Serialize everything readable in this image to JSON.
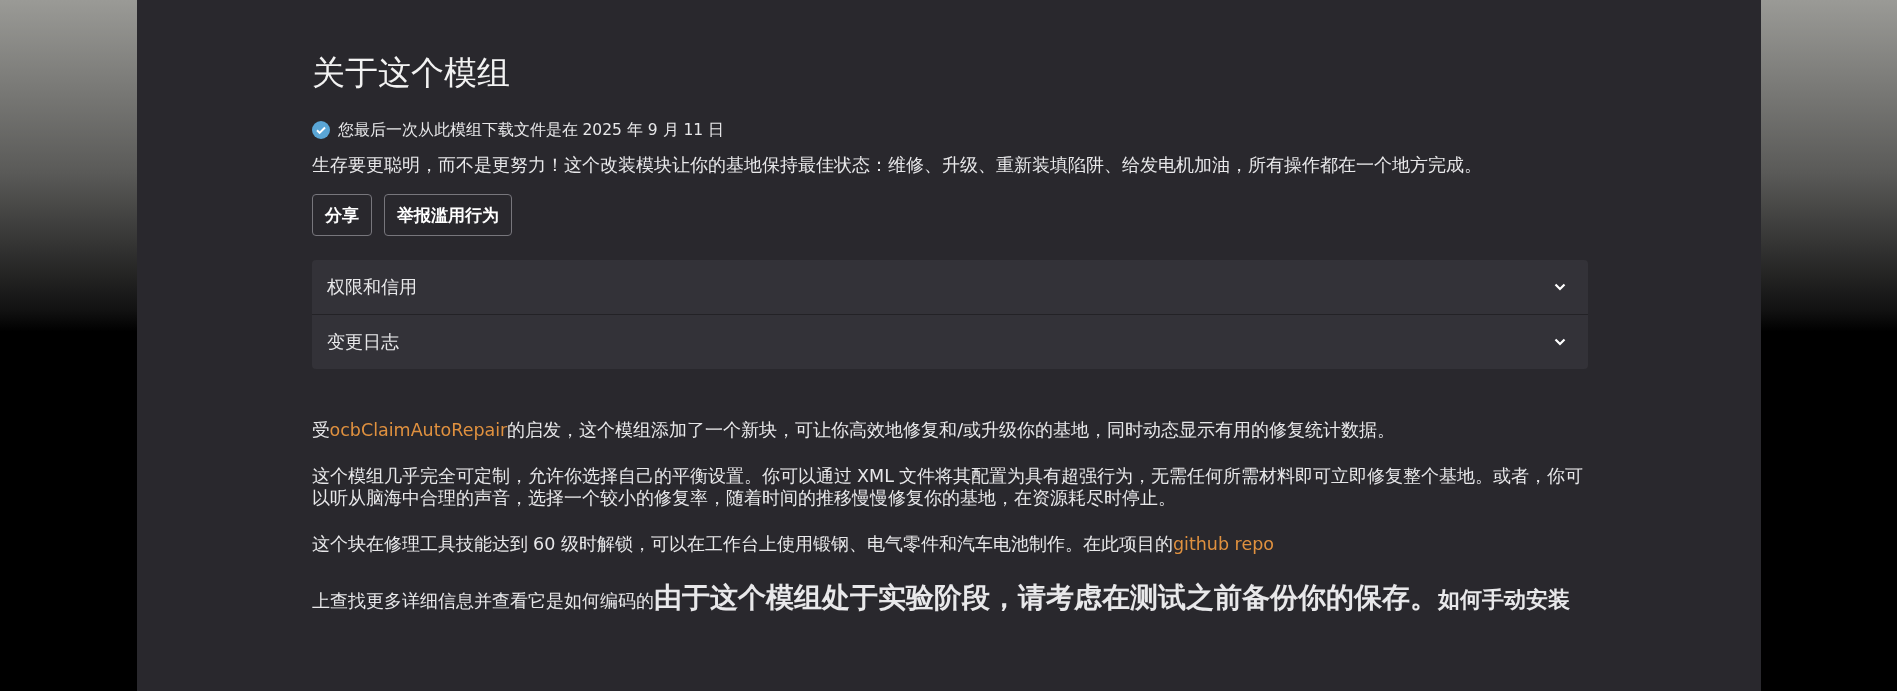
{
  "title": "关于这个模组",
  "download_notice": {
    "text": "您最后一次从此模组下载文件是在 2025 年 9 月 11 日",
    "downloaded": true
  },
  "summary": "生存要更聪明，而不是更努力！这个改装模块让你的基地保持最佳状态：维修、升级、重新装填陷阱、给发电机加油，所有操作都在一个地方完成。",
  "buttons": [
    "分享",
    "举报滥用行为"
  ],
  "accordion": [
    {
      "label": "权限和信用",
      "expanded": false
    },
    {
      "label": "变更日志",
      "expanded": false
    }
  ],
  "description": [
    {
      "kind": "text",
      "parts": [
        {
          "kind": "text",
          "text": "受"
        },
        {
          "kind": "link",
          "text": "ocbClaimAutoRepair"
        },
        {
          "kind": "text",
          "text": "的启发，这个模组添加了一个新块，可让你高效地修复和/或升级你的基地，同时动态显示有用的修复统计数据。"
        }
      ]
    },
    {
      "kind": "text",
      "parts": [
        {
          "kind": "text",
          "text": "这个模组几乎完全可定制，允许你选择自己的平衡设置。你可以通过 XML 文件将其配置为具有超强行为，无需任何所需材料即可立即修复整个基地。或者，你可以听从脑海中合理的声音，选择一个较小的修复率，随着时间的推移慢慢修复你的基地，在资源耗尽时停止。"
        }
      ]
    },
    {
      "kind": "text",
      "parts": [
        {
          "kind": "text",
          "text": "这个块在修理工具技能达到 60 级时解锁，可以在工作台上使用锻钢、电气零件和汽车电池制作。在此项目的"
        },
        {
          "kind": "link",
          "text": "github repo"
        }
      ]
    },
    {
      "kind": "mixed",
      "parts": [
        {
          "kind": "text",
          "text": "上查找更多详细信息并查看它是如何编码的"
        },
        {
          "kind": "heading",
          "text": "由于这个模组处于实验阶段，请考虑在测试之前备份你的保存。"
        },
        {
          "kind": "subheading",
          "text": "如何手动安装"
        }
      ]
    }
  ]
}
